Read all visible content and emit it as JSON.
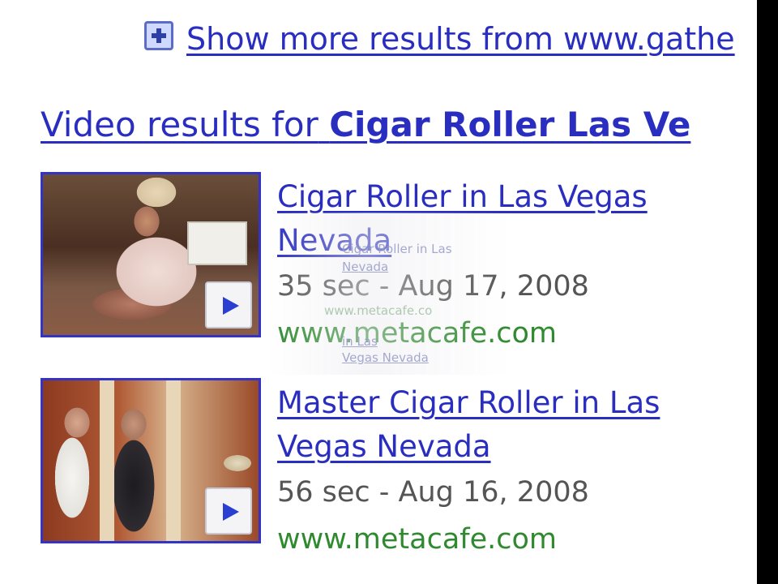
{
  "more_results": {
    "icon": "plus-box-icon",
    "link_text": "Show more results from www.gathe"
  },
  "video_section": {
    "heading_prefix": "Video results for",
    "query": "Cigar Roller Las Ve"
  },
  "results": [
    {
      "title": "Cigar Roller in Las Vegas Nevada",
      "meta": "35 sec - Aug 17, 2008",
      "url": "www.metacafe.com",
      "play_icon": "play-icon"
    },
    {
      "title": "Master Cigar Roller in Las Vegas Nevada",
      "meta": "56 sec - Aug 16, 2008",
      "url": "www.metacafe.com",
      "play_icon": "play-icon"
    }
  ],
  "ghost_overlay": {
    "line1": "Cigar Roller in Las",
    "line2": "Nevada",
    "line3": "www.metacafe.co",
    "line4": "in Las",
    "line5": "Vegas Nevada"
  },
  "colors": {
    "link": "#2a2ec0",
    "url_green": "#2f8a2f",
    "meta_gray": "#555555",
    "thumb_border": "#3334c4"
  }
}
